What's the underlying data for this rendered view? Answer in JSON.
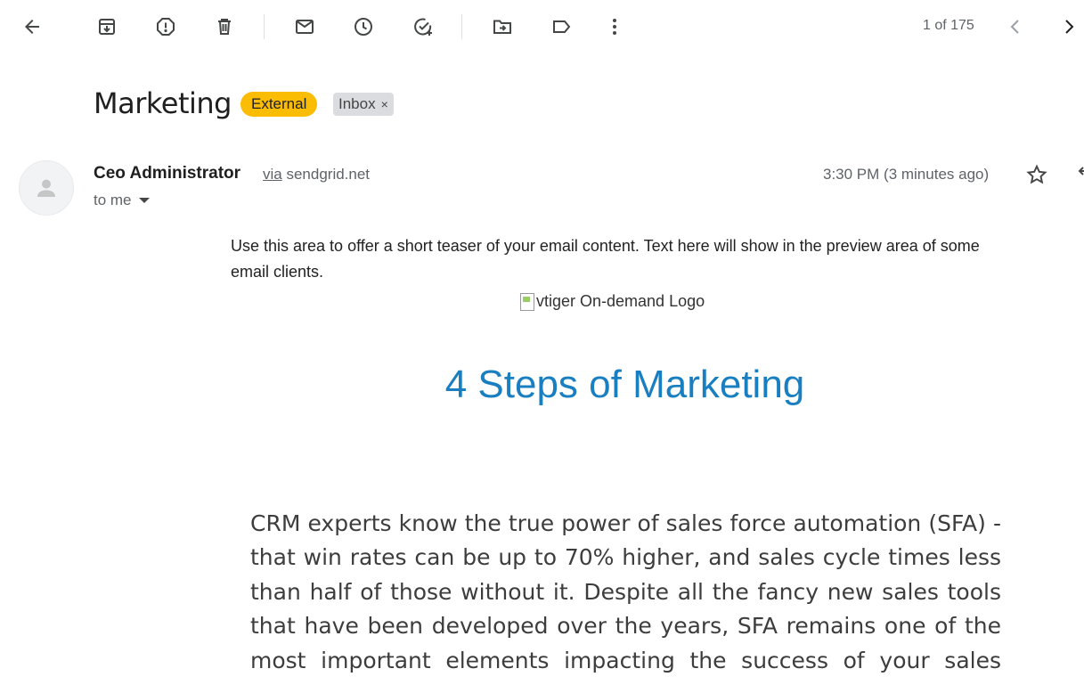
{
  "toolbar": {
    "icons": [
      "back-arrow-icon",
      "archive-icon",
      "report-spam-icon",
      "delete-icon",
      "mark-unread-icon",
      "snooze-icon",
      "add-task-icon",
      "move-to-icon",
      "label-icon",
      "more-vert-icon"
    ],
    "pager": "1 of 175",
    "prev_icon": "chevron-left-icon",
    "next_icon": "chevron-right-icon"
  },
  "email": {
    "subject": "Marketing",
    "labels": {
      "external": "External",
      "inbox": "Inbox",
      "inbox_remove": "×"
    },
    "sender": {
      "name": "Ceo Administrator",
      "via_word": "via",
      "via_domain": "sendgrid.net",
      "to": "to me",
      "timestamp": "3:30 PM (3 minutes ago)"
    },
    "body": {
      "teaser": "Use this area to offer a short teaser of your email content. Text here will show in the preview area of some email clients.",
      "logo_alt": "vtiger On-demand Logo",
      "headline": "4 Steps of Marketing",
      "paragraph": "CRM experts know the true power of sales force automation (SFA) - that win rates can be up to 70% higher, and sales cycle times less than half of those without it. Despite all the fancy new sales tools that have been developed over the years, SFA remains one of the most important elements impacting the success of your sales team and revenue performance."
    }
  },
  "colors": {
    "external_label": "#fbbc04",
    "inbox_label": "#dadce0",
    "headline": "#1a7fc1"
  }
}
